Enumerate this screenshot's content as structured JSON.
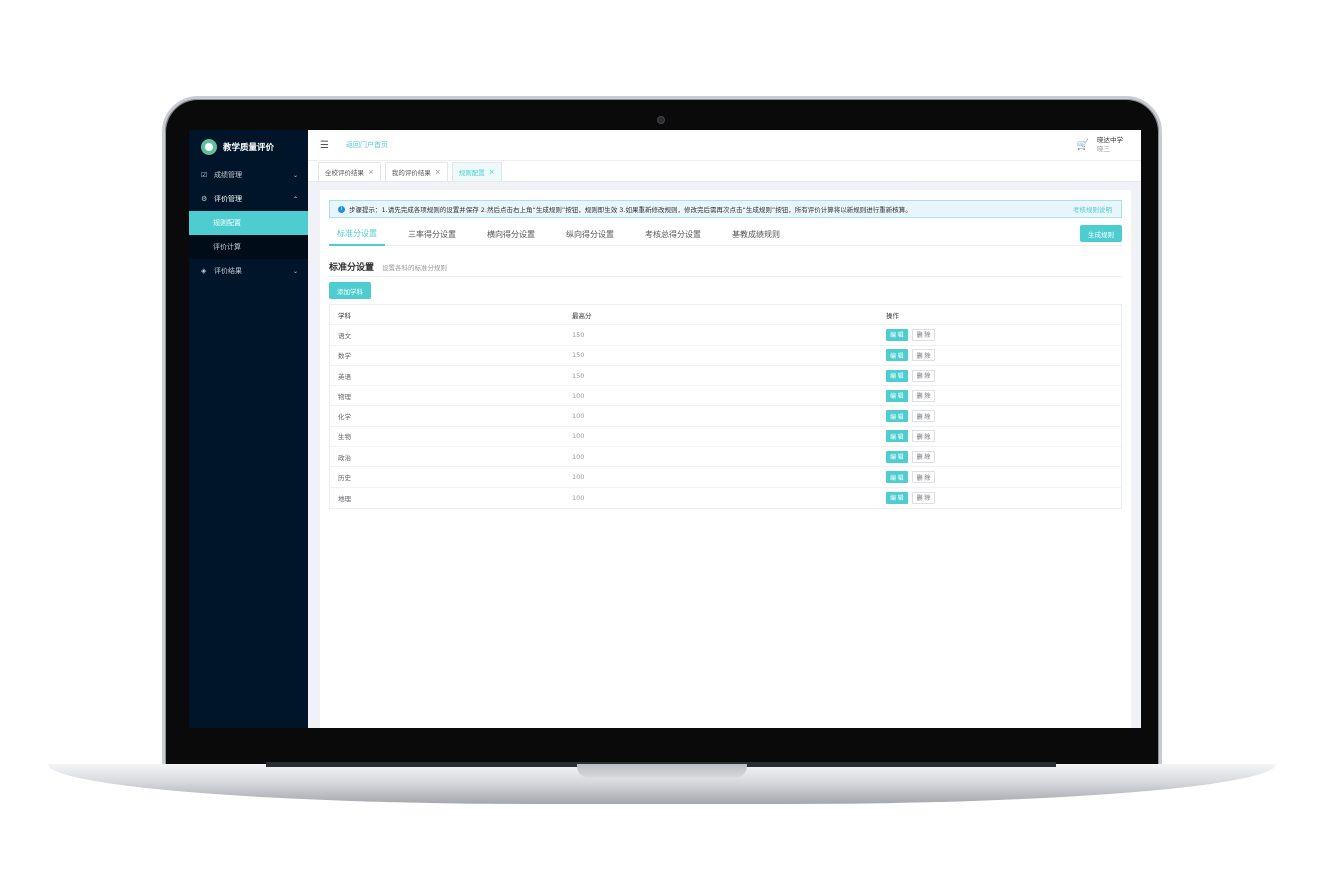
{
  "sidebar": {
    "brand": "教学质量评价",
    "menu": [
      {
        "label": "成绩管理",
        "icon": "checkbox-icon"
      },
      {
        "label": "评价管理",
        "icon": "gear-icon"
      },
      {
        "label": "评价结果",
        "icon": "tag-icon"
      }
    ],
    "sub_items": [
      "规则配置",
      "评价计算"
    ]
  },
  "header": {
    "home_link": "返回门户首页",
    "school": "晓达中学",
    "user": "晓三"
  },
  "page_tabs": [
    {
      "label": "全校评价结果"
    },
    {
      "label": "我的评价结果"
    },
    {
      "label": "规则配置"
    }
  ],
  "alert": {
    "text": "步骤提示：1.请先完成各项规则的设置并保存 2.然后点击右上角“生成规则”按钮，规则即生效 3.如果重新修改规则，修改完后需再次点击“生成规则”按钮，所有评价计算将以新规则进行重新核算。",
    "link": "考核规则说明"
  },
  "sub_tabs": [
    "标准分设置",
    "三率得分设置",
    "横向得分设置",
    "纵向得分设置",
    "考核总得分设置",
    "基教成绩规则"
  ],
  "generate_button": "生成规则",
  "section": {
    "title": "标准分设置",
    "desc": "设置各科的标准分规则"
  },
  "add_button": "添加学科",
  "table": {
    "headers": [
      "学科",
      "最高分",
      "操作"
    ],
    "edit_label": "编 辑",
    "delete_label": "删 除",
    "rows": [
      {
        "subject": "语文",
        "max": "150"
      },
      {
        "subject": "数学",
        "max": "150"
      },
      {
        "subject": "英语",
        "max": "150"
      },
      {
        "subject": "物理",
        "max": "100"
      },
      {
        "subject": "化学",
        "max": "100"
      },
      {
        "subject": "生物",
        "max": "100"
      },
      {
        "subject": "政治",
        "max": "100"
      },
      {
        "subject": "历史",
        "max": "100"
      },
      {
        "subject": "地理",
        "max": "100"
      }
    ]
  },
  "colors": {
    "accent": "#4ecdd1",
    "sidebar": "#001529"
  }
}
